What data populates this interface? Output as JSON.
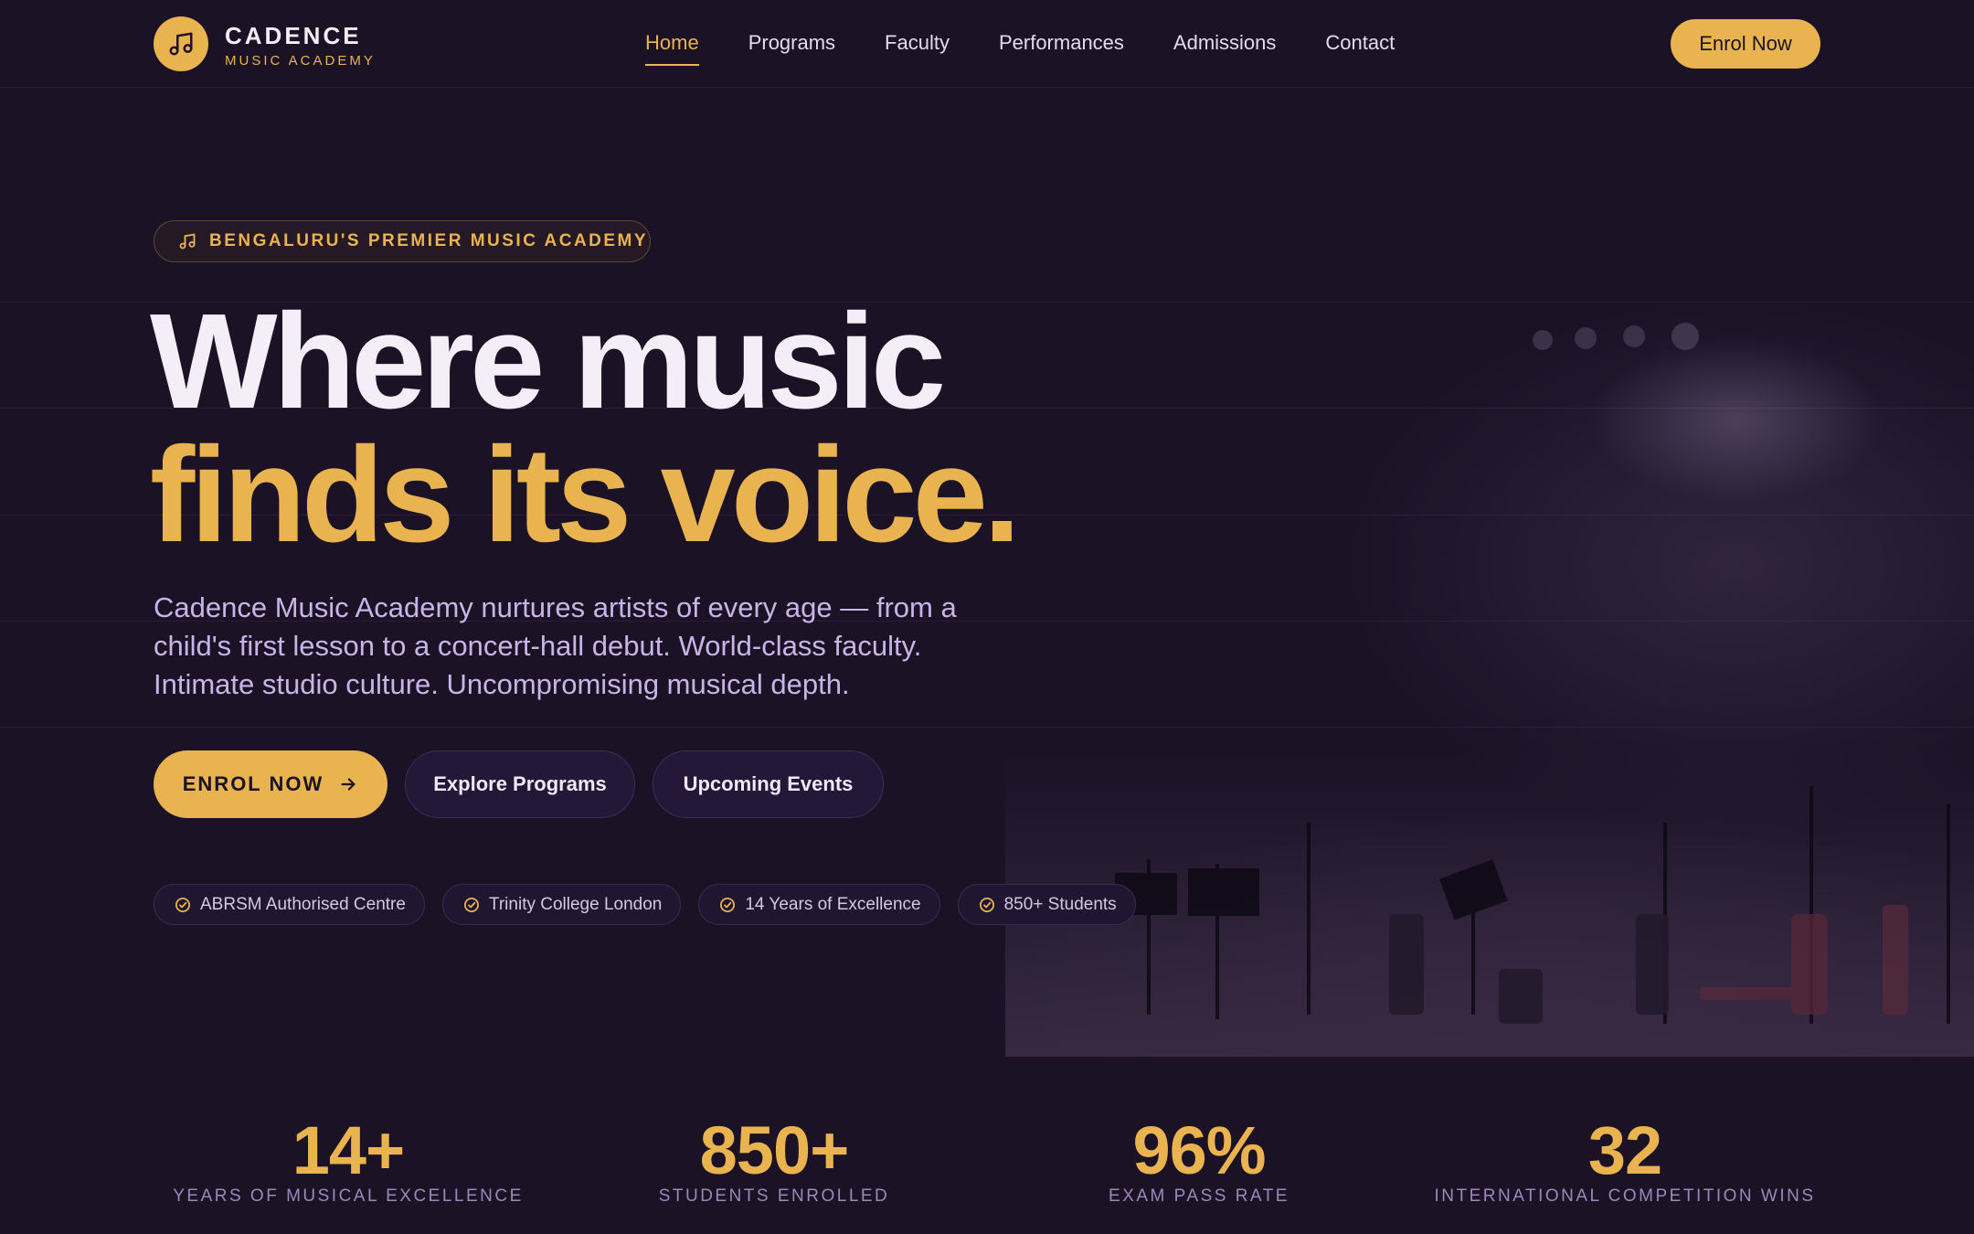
{
  "nav": {
    "brand_title": "CADENCE",
    "brand_subtitle": "MUSIC ACADEMY",
    "links": [
      "Home",
      "Programs",
      "Faculty",
      "Performances",
      "Admissions",
      "Contact"
    ],
    "active": "Home",
    "cta": "Enrol Now"
  },
  "hero": {
    "badge": "BENGALURU'S PREMIER MUSIC ACADEMY",
    "headline_line1": "Where music",
    "headline_line2": "finds its voice.",
    "lead": "Cadence Music Academy nurtures artists of every age — from a child's first lesson to a concert-hall debut. World-class faculty. Intimate studio culture. Uncompromising musical depth.",
    "buttons": {
      "primary": "ENROL NOW",
      "explore": "Explore Programs",
      "events": "Upcoming Events"
    },
    "chips": [
      "ABRSM Authorised Centre",
      "Trinity College London",
      "14 Years of Excellence",
      "850+ Students"
    ]
  },
  "stats": [
    {
      "value": "14+",
      "label": "YEARS OF MUSICAL EXCELLENCE"
    },
    {
      "value": "850+",
      "label": "STUDENTS ENROLLED"
    },
    {
      "value": "96%",
      "label": "EXAM PASS RATE"
    },
    {
      "value": "32",
      "label": "INTERNATIONAL COMPETITION WINS"
    }
  ],
  "colors": {
    "background": "#1b1226",
    "accent": "#e9b34f",
    "text": "#f3eef8",
    "muted": "#c8b4e6"
  },
  "icons": {
    "logo": "music-note-icon",
    "badge": "music-note-icon",
    "primary_button": "arrow-right-icon",
    "chip": "check-circle-icon"
  }
}
